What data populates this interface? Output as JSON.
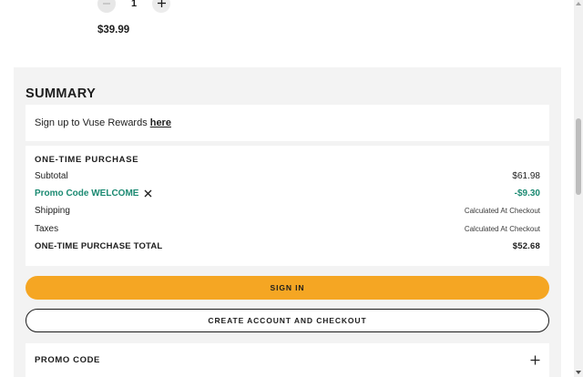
{
  "cart_item": {
    "quantity": "1",
    "price": "$39.99",
    "minus_icon": "minus-icon",
    "plus_icon": "plus-icon"
  },
  "summary": {
    "title": "SUMMARY",
    "rewards_text": "Sign up to Vuse Rewards",
    "rewards_link": "here",
    "purchase": {
      "heading": "ONE-TIME PURCHASE",
      "subtotal_label": "Subtotal",
      "subtotal_value": "$61.98",
      "promo_label": "Promo Code WELCOME",
      "promo_value": "-$9.30",
      "shipping_label": "Shipping",
      "shipping_value": "Calculated At Checkout",
      "taxes_label": "Taxes",
      "taxes_value": "Calculated At Checkout",
      "total_label": "ONE-TIME PURCHASE TOTAL",
      "total_value": "$52.68"
    },
    "sign_in_label": "SIGN IN",
    "create_account_label": "CREATE ACCOUNT AND CHECKOUT",
    "promo_code_label": "PROMO CODE"
  },
  "colors": {
    "accent": "#f5a623",
    "promo_green": "#1b8a72",
    "panel_bg": "#f3f3f3"
  }
}
